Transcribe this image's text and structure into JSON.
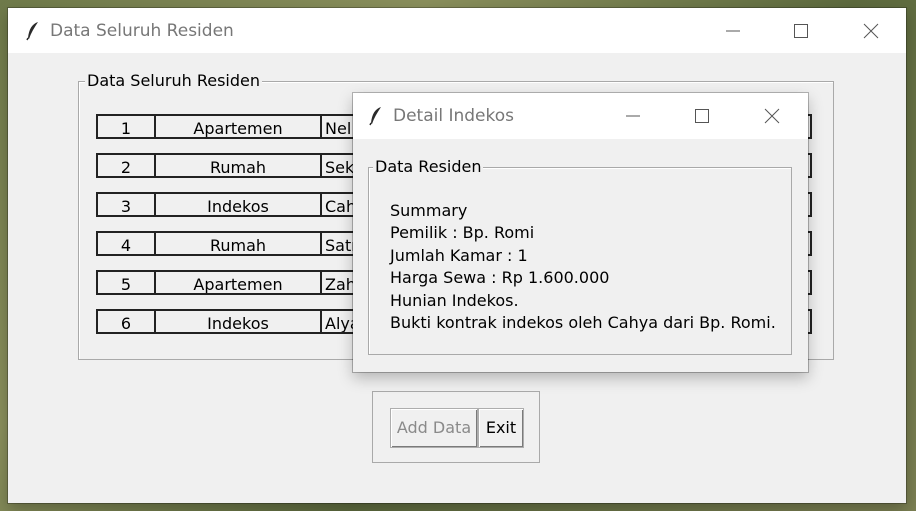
{
  "main_window": {
    "title": "Data Seluruh Residen",
    "group_label": "Data Seluruh Residen",
    "rows": [
      {
        "no": "1",
        "type": "Apartemen",
        "name": "Nel"
      },
      {
        "no": "2",
        "type": "Rumah",
        "name": "Sek"
      },
      {
        "no": "3",
        "type": "Indekos",
        "name": "Cah"
      },
      {
        "no": "4",
        "type": "Rumah",
        "name": "Satr"
      },
      {
        "no": "5",
        "type": "Apartemen",
        "name": "Zah"
      },
      {
        "no": "6",
        "type": "Indekos",
        "name": "Alya"
      }
    ],
    "add_button": "Add Data",
    "exit_button": "Exit"
  },
  "dialog": {
    "title": "Detail Indekos",
    "group_label": "Data Residen",
    "summary_lines": [
      "Summary",
      "Pemilik : Bp. Romi",
      "Jumlah Kamar : 1",
      "Harga Sewa : Rp 1.600.000",
      "Hunian Indekos.",
      "Bukti kontrak indekos oleh Cahya dari Bp. Romi."
    ]
  },
  "colors": {
    "titlebar_bg": "#ffffff",
    "window_bg": "#f0f0f0",
    "title_text": "#777777",
    "disabled_text": "#8a8a8a"
  },
  "icons": [
    "feather-icon",
    "minimize-icon",
    "maximize-icon",
    "close-icon"
  ]
}
